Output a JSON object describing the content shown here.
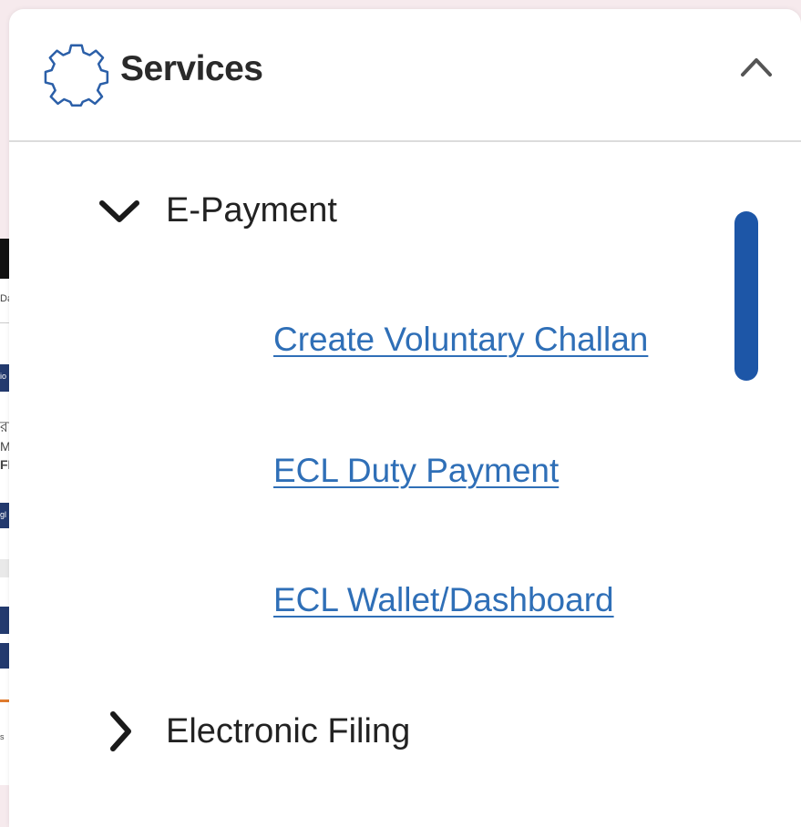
{
  "background_page": {
    "fragments": [
      "Da",
      "io",
      "রা",
      "M",
      "FI",
      "gl",
      "s"
    ]
  },
  "panel": {
    "title": "Services",
    "header_icon": "gear-icon",
    "collapse_icon": "chevron-up-icon"
  },
  "sections": [
    {
      "label": "E-Payment",
      "expanded": true,
      "icon": "chevron-down-icon",
      "links": [
        "Create Voluntary Challan",
        "ECL Duty Payment",
        "ECL Wallet/Dashboard"
      ]
    },
    {
      "label": "Electronic Filing",
      "expanded": false,
      "icon": "chevron-right-icon"
    }
  ],
  "colors": {
    "link": "#2f6fb7",
    "scrollbar": "#1d56a7",
    "gear_outline": "#2b5fa8",
    "backdrop": "#f6eaed"
  }
}
